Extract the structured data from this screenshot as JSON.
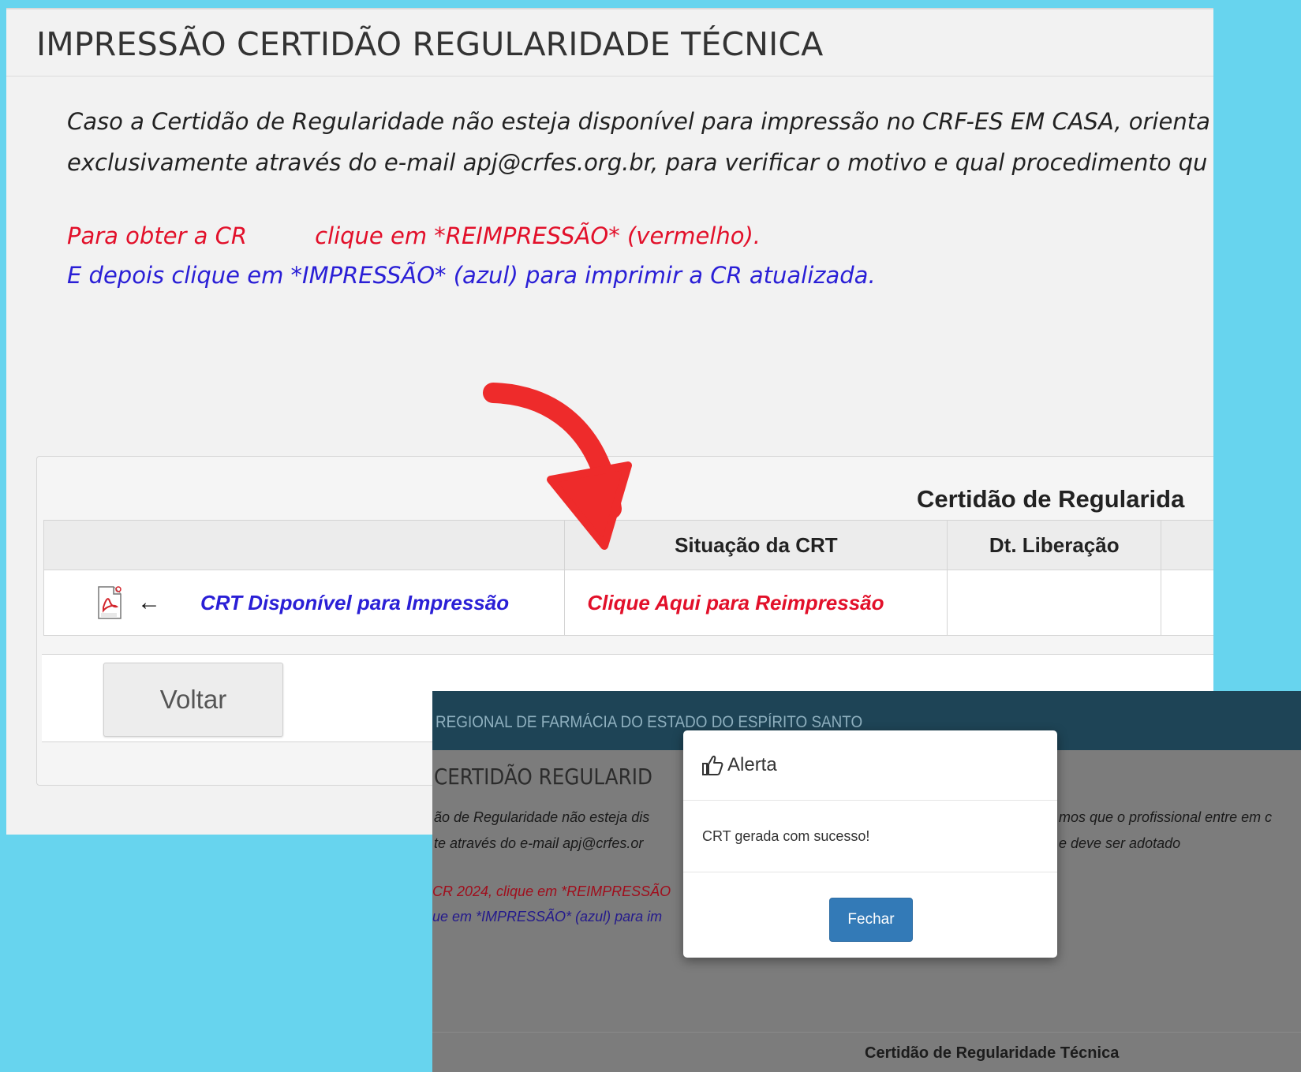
{
  "page": {
    "title": "IMPRESSÃO CERTIDÃO REGULARIDADE TÉCNICA",
    "notice_line1": "Caso a Certidão de Regularidade não esteja disponível para impressão no CRF-ES EM CASA, orienta",
    "notice_line2": "exclusivamente através do e-mail apj@crfes.org.br, para verificar o motivo e qual procedimento qu",
    "red_instruction_part1": "Para obter a CR",
    "red_instruction_part2": "clique em *REIMPRESSÃO* (vermelho).",
    "blue_instruction": "E depois clique em *IMPRESSÃO* (azul) para imprimir a CR atualizada."
  },
  "panel": {
    "title": "Certidão de Regularida",
    "columns": [
      "",
      "Situação da CRT",
      "Dt. Liberação",
      ""
    ],
    "row": {
      "print_link": "CRT Disponível para Impressão",
      "reprint_link": "Clique Aqui para Reimpressão",
      "release_date": "",
      "icons": [
        "pdf-icon",
        "arrow-left-icon"
      ]
    },
    "back_button": "Voltar"
  },
  "overlay_screenshot": {
    "org_name": "REGIONAL DE FARMÁCIA DO ESTADO DO ESPÍRITO SANTO",
    "bg_title": "CERTIDÃO REGULARID",
    "bg_line1_left": "ão de Regularidade não esteja dis",
    "bg_line1_right": "mos que o profissional entre em c",
    "bg_line2_left": "te através do e-mail apj@crfes.or",
    "bg_line2_right": "e deve ser adotado",
    "bg_red": "CR 2024, clique em *REIMPRESSÃO",
    "bg_blue": "ue em *IMPRESSÃO* (azul) para im",
    "bg_table_title": "Certidão de Regularidade Técnica",
    "modal": {
      "title": "Alerta",
      "message": "CRT gerada com sucesso!",
      "close_button": "Fechar",
      "icon": "thumbs-up-icon"
    }
  },
  "colors": {
    "background": "#67d4ee",
    "red_text": "#e2102a",
    "blue_text": "#2a1fd6",
    "arrow": "#ee2b2b",
    "topbar": "#1e4456",
    "primary_button": "#337ab7"
  }
}
